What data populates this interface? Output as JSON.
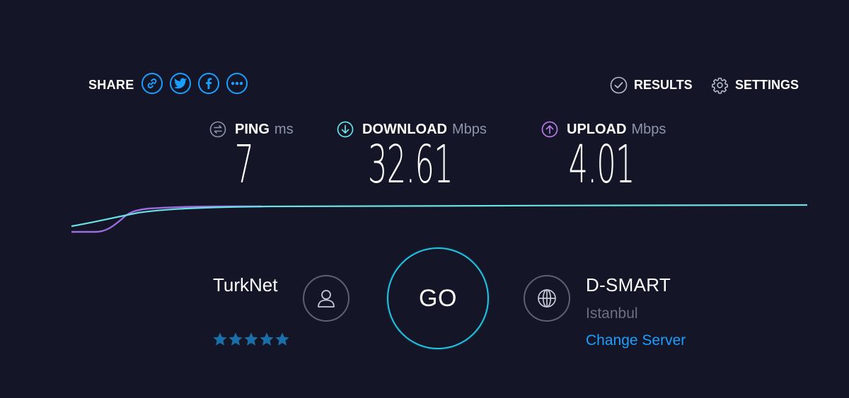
{
  "share": {
    "label": "SHARE",
    "buttons": [
      {
        "icon": "link-icon"
      },
      {
        "icon": "twitter-icon"
      },
      {
        "icon": "facebook-icon"
      },
      {
        "icon": "more-icon"
      }
    ]
  },
  "nav": {
    "results_label": "RESULTS",
    "settings_label": "SETTINGS"
  },
  "metrics": {
    "ping": {
      "label": "PING",
      "unit": "ms",
      "value": "7",
      "icon": "ping-icon"
    },
    "download": {
      "label": "DOWNLOAD",
      "unit": "Mbps",
      "value": "32.61",
      "icon": "download-arrow-icon"
    },
    "upload": {
      "label": "UPLOAD",
      "unit": "Mbps",
      "value": "4.01",
      "icon": "upload-arrow-icon"
    }
  },
  "isp": {
    "name": "TurkNet",
    "rating": 5,
    "rating_max": 5
  },
  "go_button": {
    "label": "GO"
  },
  "server": {
    "name": "D-SMART",
    "location": "Istanbul",
    "change_label": "Change Server"
  },
  "colors": {
    "background": "#141527",
    "accent_blue": "#1a9fff",
    "download_cyan": "#6be0e4",
    "upload_purple": "#9b6ddf",
    "go_ring": "#24c3e0",
    "star": "#1b6fa8"
  }
}
